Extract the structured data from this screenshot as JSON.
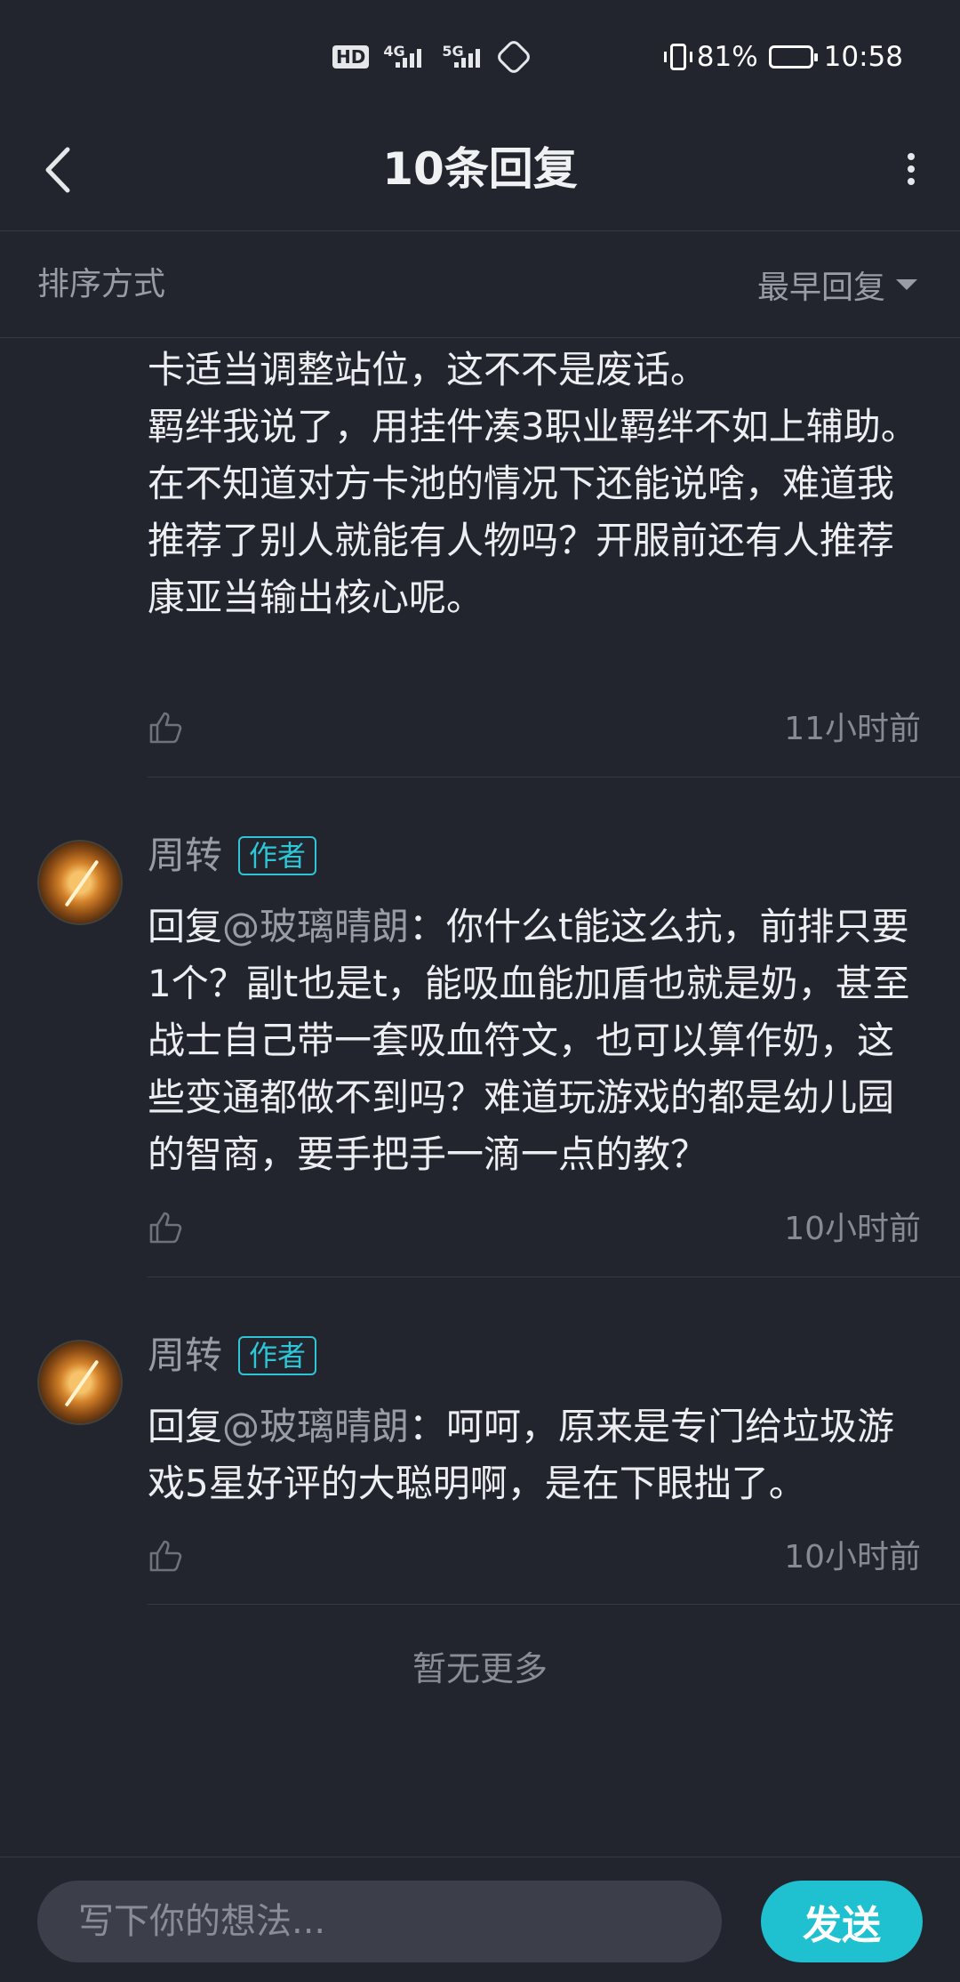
{
  "status_bar": {
    "hd_badge": "HD",
    "sim_badge": "2",
    "net1_label": "4G",
    "net2_label": "5G",
    "battery_percent": "81%",
    "battery_level": 0.81,
    "time": "10:58"
  },
  "header": {
    "title": "10条回复",
    "back_icon": "chevron-left-icon",
    "more_icon": "more-vertical-icon"
  },
  "sort": {
    "label": "排序方式",
    "selected": "最早回复"
  },
  "comments": [
    {
      "text": "卡适当调整站位，这不不是废话。\n羁绊我说了，用挂件凑3职业羁绊不如上辅助。\n在不知道对方卡池的情况下还能说啥，难道我推荐了别人就能有人物吗？开服前还有人推荐康亚当输出核心呢。",
      "time": "11小时前"
    },
    {
      "username": "周转",
      "badge": "作者",
      "reply_prefix": "回复",
      "mention": "@玻璃晴朗",
      "text": "：你什么t能这么抗，前排只要1个？副t也是t，能吸血能加盾也就是奶，甚至战士自己带一套吸血符文，也可以算作奶，这些变通都做不到吗？难道玩游戏的都是幼儿园的智商，要手把手一滴一点的教？",
      "time": "10小时前"
    },
    {
      "username": "周转",
      "badge": "作者",
      "reply_prefix": "回复",
      "mention": "@玻璃晴朗",
      "text": "：呵呵，原来是专门给垃圾游戏5星好评的大聪明啊，是在下眼拙了。",
      "time": "10小时前"
    }
  ],
  "no_more": "暂无更多",
  "input": {
    "placeholder": "写下你的想法..."
  },
  "send_label": "发送",
  "colors": {
    "background": "#23252e",
    "accent": "#1fc0cf",
    "badge": "#2ec6d6",
    "muted_text": "#9a9ca5"
  }
}
